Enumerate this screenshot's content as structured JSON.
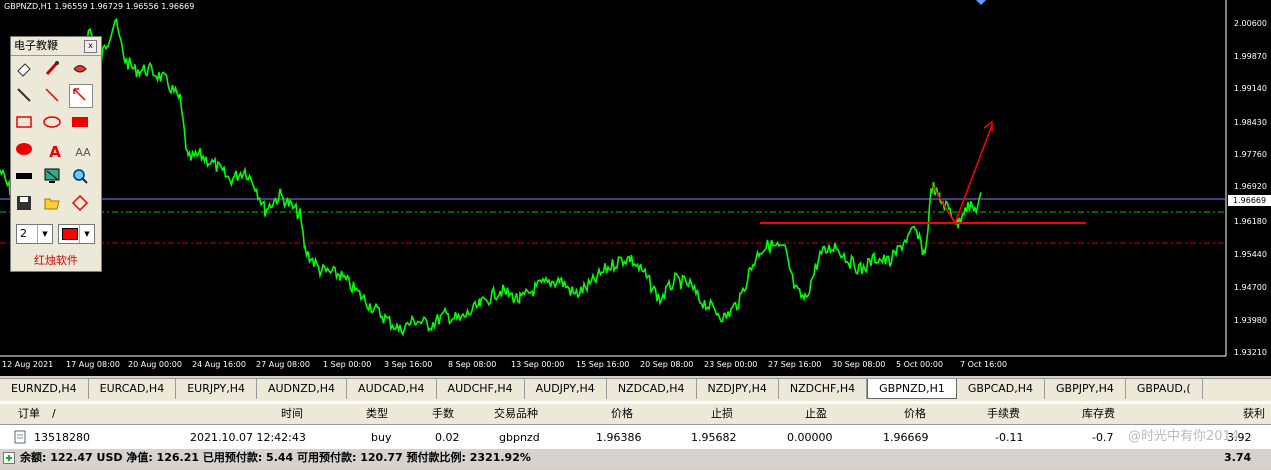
{
  "symbol_info": "GBPNZD,H1  1.96559 1.96729 1.96556 1.96669",
  "current_price": "1.96669",
  "price_axis": [
    "2.00600",
    "1.99870",
    "1.99140",
    "1.98430",
    "1.97760",
    "1.96920",
    "1.96180",
    "1.95440",
    "1.94700",
    "1.93980",
    "1.93210"
  ],
  "time_axis": [
    "12 Aug 2021",
    "17 Aug 08:00",
    "20 Aug 00:00",
    "24 Aug 16:00",
    "27 Aug 08:00",
    "1 Sep 00:00",
    "3 Sep 16:00",
    "8 Sep 08:00",
    "13 Sep 00:00",
    "15 Sep 16:00",
    "20 Sep 08:00",
    "23 Sep 00:00",
    "27 Sep 16:00",
    "30 Sep 08:00",
    "5 Oct 00:00",
    "7 Oct 16:00"
  ],
  "palette": {
    "title": "电子教鞭",
    "close_label": "x",
    "line_width": "2",
    "color": "#ff0000",
    "brand": "红烛软件"
  },
  "tabs": [
    "EURNZD,H4",
    "EURCAD,H4",
    "EURJPY,H4",
    "AUDNZD,H4",
    "AUDCAD,H4",
    "AUDCHF,H4",
    "AUDJPY,H4",
    "NZDCAD,H4",
    "NZDJPY,H4",
    "NZDCHF,H4",
    "GBPNZD,H1",
    "GBPCAD,H4",
    "GBPJPY,H4",
    "GBPAUD,("
  ],
  "active_tab": "GBPNZD,H1",
  "terminal": {
    "headers": {
      "order": "订单",
      "sort": "/",
      "time": "时间",
      "type": "类型",
      "lots": "手数",
      "symbol": "交易品种",
      "price": "价格",
      "sl": "止损",
      "tp": "止盈",
      "cur_price": "价格",
      "commission": "手续费",
      "swap": "库存费",
      "profit": "获利"
    },
    "row": {
      "order": "13518280",
      "time": "2021.10.07 12:42:43",
      "type": "buy",
      "lots": "0.02",
      "symbol": "gbpnzd",
      "price": "1.96386",
      "sl": "1.95682",
      "tp": "0.00000",
      "cur_price": "1.96669",
      "commission": "-0.11",
      "swap": "-0.7",
      "profit": "3.92"
    },
    "footer": "余额: 122.47 USD  净值: 126.21  已用预付款: 5.44  可用预付款: 120.77  预付款比例: 2321.92%",
    "footer_total": "3.74"
  },
  "watermark": "@时光中有你2014",
  "colors": {
    "bg": "#000000",
    "candles": "#00ff00",
    "trend": "#ff0000",
    "bid_line": "#8080ff"
  }
}
